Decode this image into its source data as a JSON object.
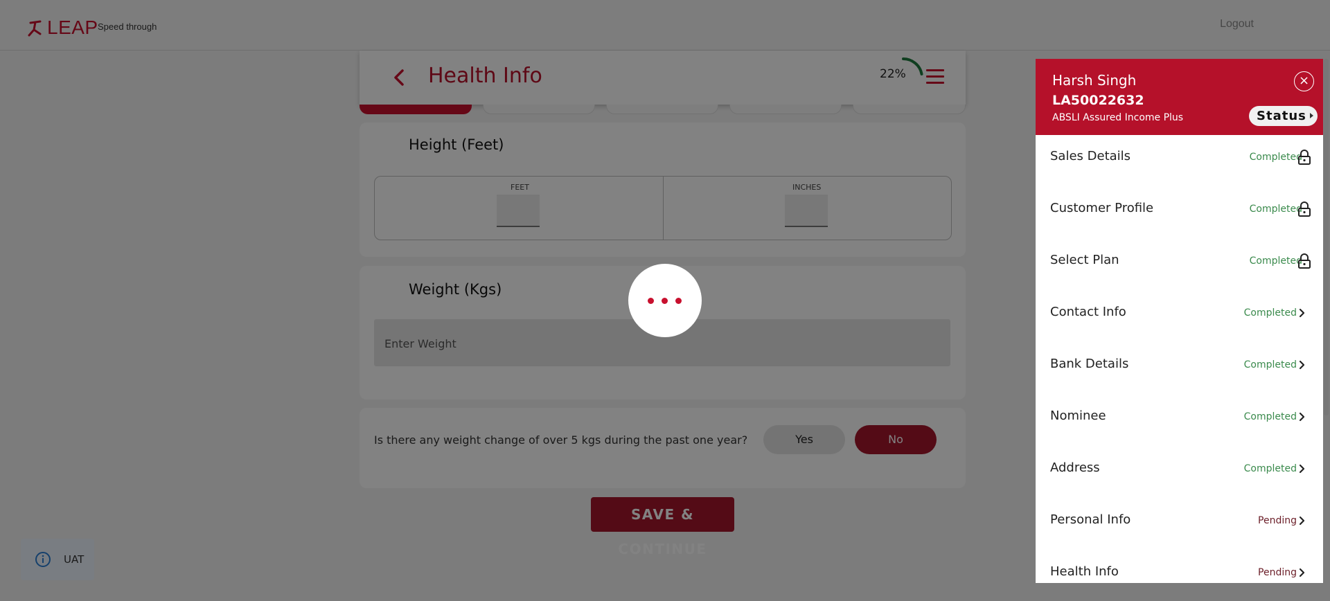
{
  "app": {
    "logo": "LEAP",
    "tagline": "Speed through",
    "logout": "Logout"
  },
  "page": {
    "title": "Health Info",
    "progress_text": "22%",
    "progress": 0.22
  },
  "height": {
    "title": "Height (Feet)",
    "feet_label": "FEET",
    "inches_label": "INCHES",
    "feet_value": "",
    "inches_value": ""
  },
  "weight": {
    "title": "Weight (Kgs)",
    "placeholder": "Enter Weight"
  },
  "question": {
    "text": "Is there any weight change of over 5 kgs during the past one year?",
    "yes": "Yes",
    "no": "No",
    "selected": "No"
  },
  "actions": {
    "save": "SAVE & CONTINUE"
  },
  "side": {
    "name": "Harsh Singh",
    "id": "LA50022632",
    "plan": "ABSLI Assured Income Plus",
    "status_label": "Status",
    "items": [
      {
        "label": "Sales Details",
        "status": "Completed",
        "icon": "lock-icon"
      },
      {
        "label": "Customer Profile",
        "status": "Completed",
        "icon": "lock-icon"
      },
      {
        "label": "Select Plan",
        "status": "Completed",
        "icon": "lock-icon"
      },
      {
        "label": "Contact Info",
        "status": "Completed",
        "icon": "chevron-right-icon"
      },
      {
        "label": "Bank Details",
        "status": "Completed",
        "icon": "chevron-right-icon"
      },
      {
        "label": "Nominee",
        "status": "Completed",
        "icon": "chevron-right-icon"
      },
      {
        "label": "Address",
        "status": "Completed",
        "icon": "chevron-right-icon"
      },
      {
        "label": "Personal Info",
        "status": "Pending",
        "icon": "chevron-right-icon"
      },
      {
        "label": "Health Info",
        "status": "Pending",
        "icon": "chevron-right-icon"
      }
    ]
  },
  "env": {
    "label": "UAT"
  },
  "colors": {
    "brand": "#c8102e",
    "brand_dark": "#a5162b",
    "completed": "#3a8a4c",
    "pending": "#6b1e28"
  }
}
